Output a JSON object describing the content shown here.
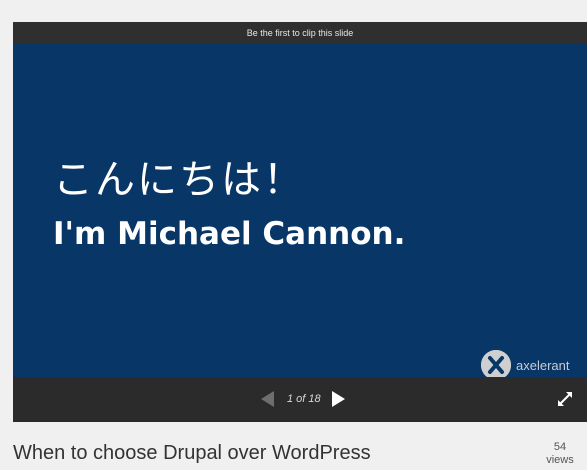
{
  "player": {
    "clip_notice": "Be the first to clip this slide",
    "slide": {
      "greeting_japanese": "こんにちは！",
      "intro": "I'm Michael Cannon.",
      "brand_name": "axelerant",
      "background_color": "#083767"
    },
    "progress": {
      "current_slide": 1,
      "total_slides": 18,
      "fraction": 0.056,
      "fill_color": "#1b89c8"
    },
    "controls": {
      "counter_text": "1 of 18",
      "prev_icon": "arrow-left-icon",
      "next_icon": "arrow-right-icon",
      "fullscreen_icon": "expand-icon"
    }
  },
  "deck": {
    "title": "When to choose Drupal over WordPress",
    "views_count": "54",
    "views_label": "views"
  }
}
